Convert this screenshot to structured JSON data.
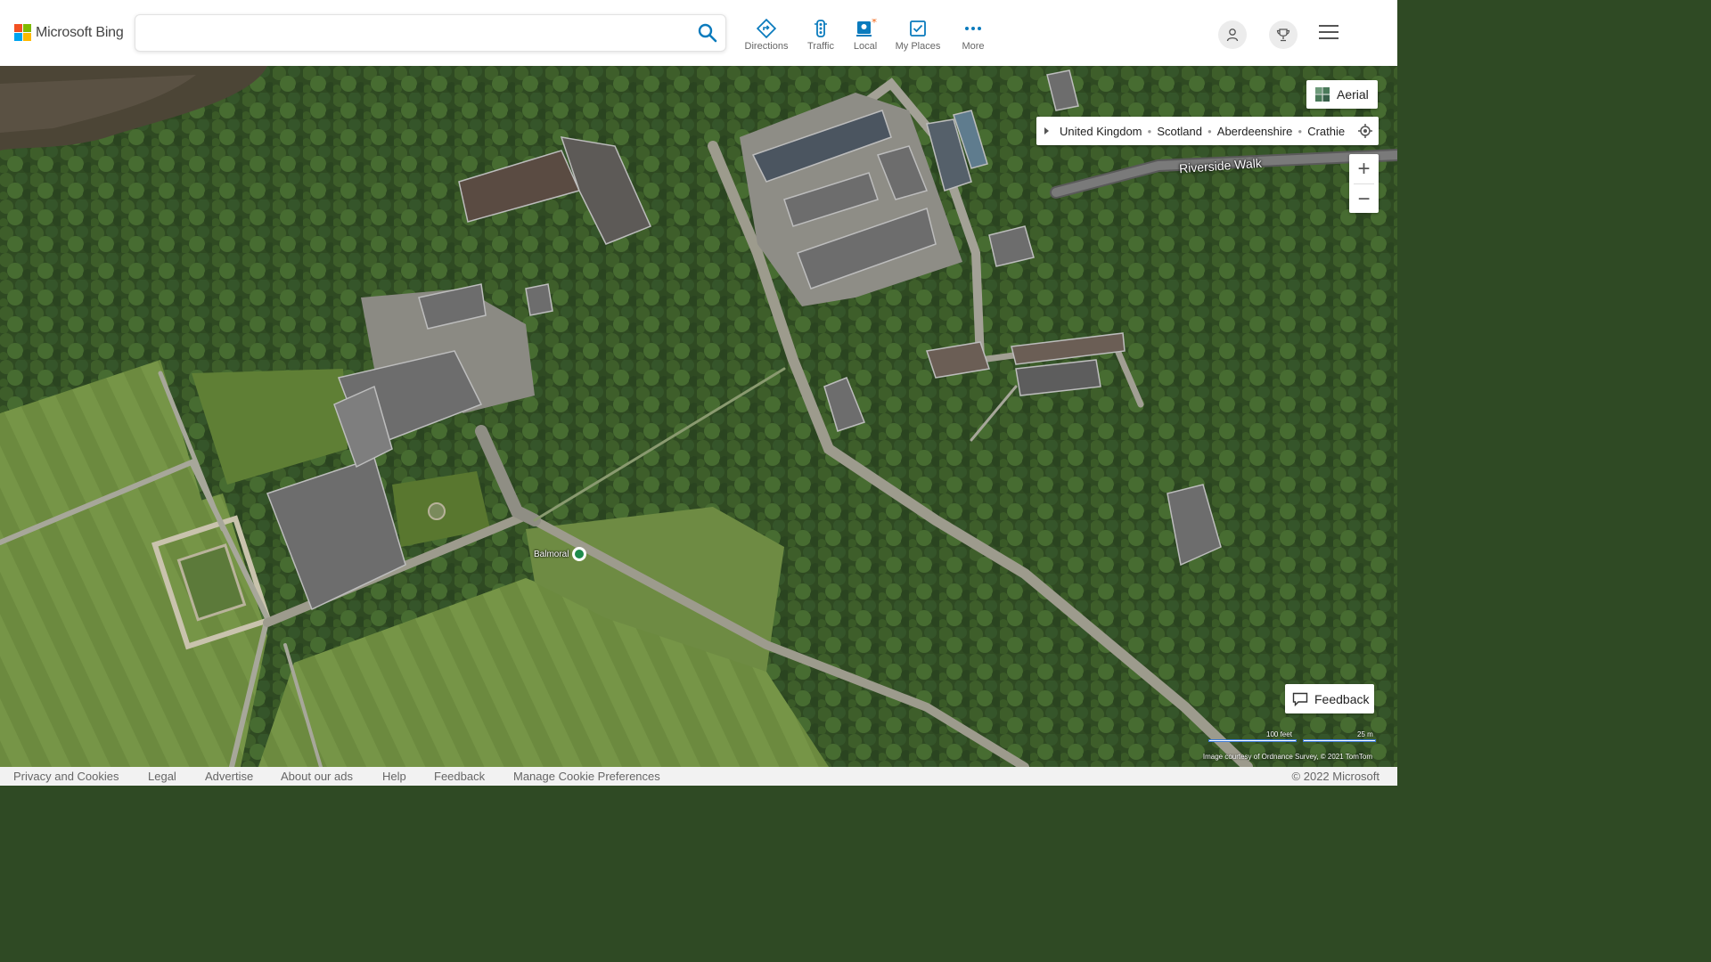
{
  "brand": {
    "name": "Microsoft Bing",
    "logo_colors": [
      "#f25022",
      "#7fba00",
      "#00a4ef",
      "#ffb900"
    ]
  },
  "search": {
    "value": "",
    "placeholder": ""
  },
  "nav": {
    "items": [
      {
        "label": "Directions",
        "icon": "directions-icon"
      },
      {
        "label": "Traffic",
        "icon": "traffic-light-icon"
      },
      {
        "label": "Local",
        "icon": "local-pin-icon"
      },
      {
        "label": "My Places",
        "icon": "my-places-icon"
      },
      {
        "label": "More",
        "icon": "more-dots-icon"
      }
    ]
  },
  "map": {
    "style_label": "Aerial",
    "breadcrumb": [
      "United Kingdom",
      "Scotland",
      "Aberdeenshire",
      "Crathie"
    ],
    "road_label": "Riverside Walk",
    "poi_label": "Balmoral",
    "zoom_in": "+",
    "zoom_out": "−",
    "feedback_label": "Feedback",
    "scale": {
      "feet": "100 feet",
      "meters": "25 m"
    },
    "attribution": "Image courtesy of Ordnance Survey, © 2021 TomTom"
  },
  "footer": {
    "links": [
      "Privacy and Cookies",
      "Legal",
      "Advertise",
      "About our ads",
      "Help",
      "Feedback",
      "Manage Cookie Preferences"
    ],
    "copyright": "© 2022 Microsoft"
  },
  "colors": {
    "accent": "#0b7bbd",
    "local_badge": "#f36c21",
    "poi_green": "#1e8b4c"
  }
}
